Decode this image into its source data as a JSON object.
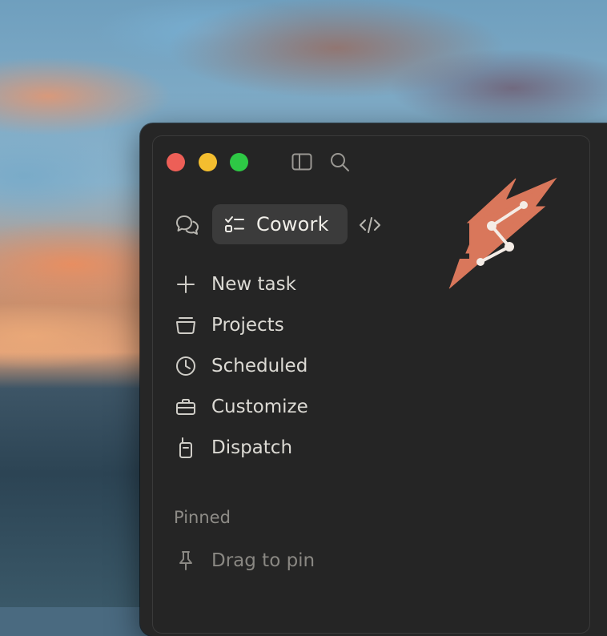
{
  "colors": {
    "window_bg": "#262626",
    "active_tab_bg": "#3b3b3b",
    "text_primary": "#dcdad4",
    "text_muted": "#8e8c87",
    "logo_accent": "#d9775b",
    "close": "#ed5f57",
    "minimize": "#f4be2f",
    "maximize": "#2ec845"
  },
  "toolbar": {
    "icons": [
      "sidebar-toggle-icon",
      "search-icon"
    ]
  },
  "modes": {
    "chat_icon": "chat-bubbles-icon",
    "active_label": "Cowork",
    "active_icon": "checklist-icon",
    "code_icon": "code-icon"
  },
  "nav": {
    "items": [
      {
        "label": "New task",
        "icon": "plus-icon"
      },
      {
        "label": "Projects",
        "icon": "folder-stack-icon"
      },
      {
        "label": "Scheduled",
        "icon": "clock-icon"
      },
      {
        "label": "Customize",
        "icon": "briefcase-icon"
      },
      {
        "label": "Dispatch",
        "icon": "walkie-talkie-icon"
      }
    ]
  },
  "pinned": {
    "label": "Pinned",
    "placeholder": "Drag to pin",
    "icon": "pin-icon"
  },
  "logo": {
    "icon": "lightning-logo-icon"
  }
}
